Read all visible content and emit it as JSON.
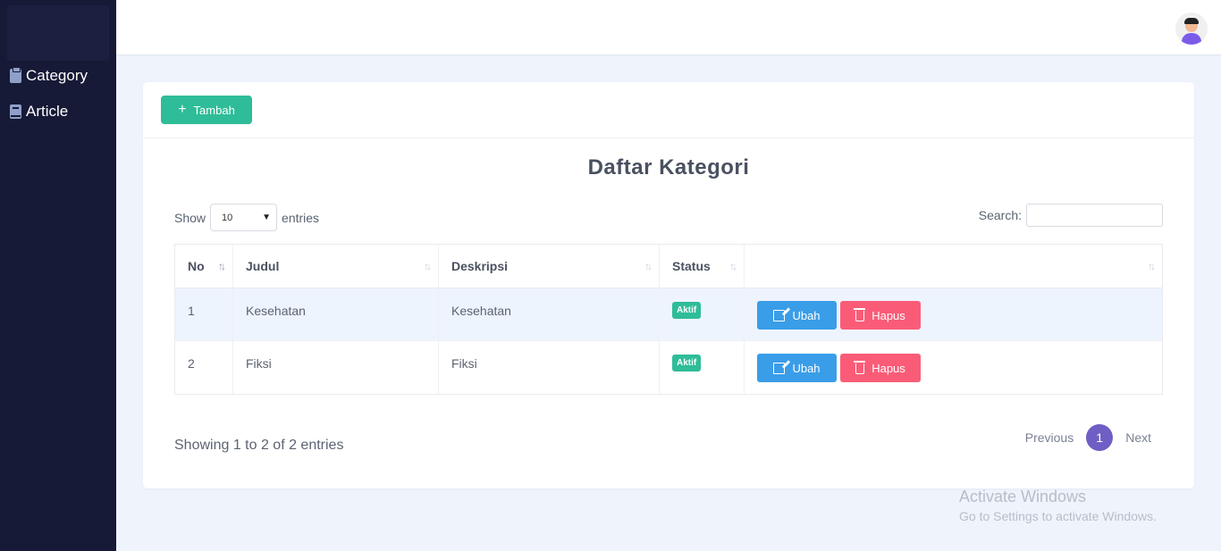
{
  "sidebar": {
    "items": [
      {
        "label": "Category",
        "icon": "clipboard-icon"
      },
      {
        "label": "Article",
        "icon": "book-icon"
      }
    ]
  },
  "header": {
    "avatar_icon": "user-avatar-icon"
  },
  "toolbar": {
    "add_label": "Tambah"
  },
  "page": {
    "title": "Daftar Kategori"
  },
  "table_controls": {
    "show_label": "Show",
    "entries_value": "10",
    "entries_label": "entries",
    "search_label": "Search:",
    "search_value": ""
  },
  "table": {
    "columns": [
      "No",
      "Judul",
      "Deskripsi",
      "Status",
      ""
    ],
    "rows": [
      {
        "no": "1",
        "judul": "Kesehatan",
        "deskripsi": "Kesehatan",
        "status": "Aktif",
        "edit": "Ubah",
        "delete": "Hapus"
      },
      {
        "no": "2",
        "judul": "Fiksi",
        "deskripsi": "Fiksi",
        "status": "Aktif",
        "edit": "Ubah",
        "delete": "Hapus"
      }
    ]
  },
  "footer": {
    "info": "Showing 1 to 2 of 2 entries",
    "previous": "Previous",
    "page": "1",
    "next": "Next"
  },
  "watermark": {
    "line1": "Activate Windows",
    "line2": "Go to Settings to activate Windows."
  },
  "colors": {
    "sidebar": "#161a36",
    "accent_green": "#2ebd98",
    "edit_blue": "#3a9de8",
    "delete_red": "#fa5c78",
    "page_purple": "#6f5fc4"
  }
}
